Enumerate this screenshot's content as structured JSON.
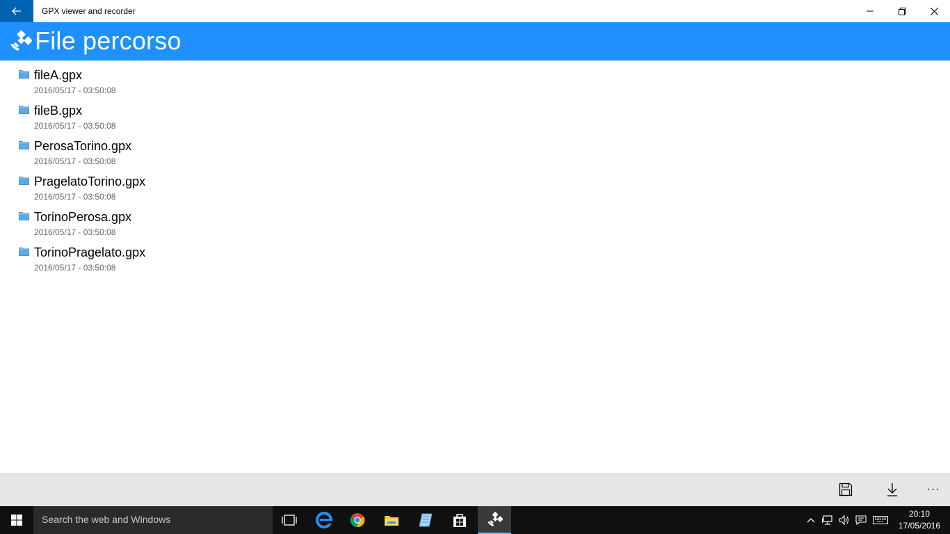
{
  "window": {
    "title": "GPX viewer and recorder"
  },
  "header": {
    "title": "File percorso",
    "color": "#1e90ff"
  },
  "files": [
    {
      "name": "fileA.gpx",
      "date": "2016/05/17 - 03:50:08",
      "icon": "folder-icon"
    },
    {
      "name": "fileB.gpx",
      "date": "2016/05/17 - 03:50:08",
      "icon": "folder-icon"
    },
    {
      "name": "PerosaTorino.gpx",
      "date": "2016/05/17 - 03:50:08",
      "icon": "folder-icon"
    },
    {
      "name": "PragelatoTorino.gpx",
      "date": "2016/05/17 - 03:50:08",
      "icon": "folder-icon"
    },
    {
      "name": "TorinoPerosa.gpx",
      "date": "2016/05/17 - 03:50:08",
      "icon": "folder-icon"
    },
    {
      "name": "TorinoPragelato.gpx",
      "date": "2016/05/17 - 03:50:08",
      "icon": "folder-icon"
    }
  ],
  "commandbar": {
    "buttons": [
      "save-icon",
      "download-icon"
    ],
    "more": "···"
  },
  "taskbar": {
    "search_placeholder": "Search the web and Windows",
    "apps": [
      "task-view-icon",
      "edge-icon",
      "chrome-icon",
      "file-explorer-icon",
      "notepad-icon",
      "store-icon",
      "gpx-app-icon"
    ],
    "clock_time": "20:10",
    "clock_date": "17/05/2016"
  }
}
